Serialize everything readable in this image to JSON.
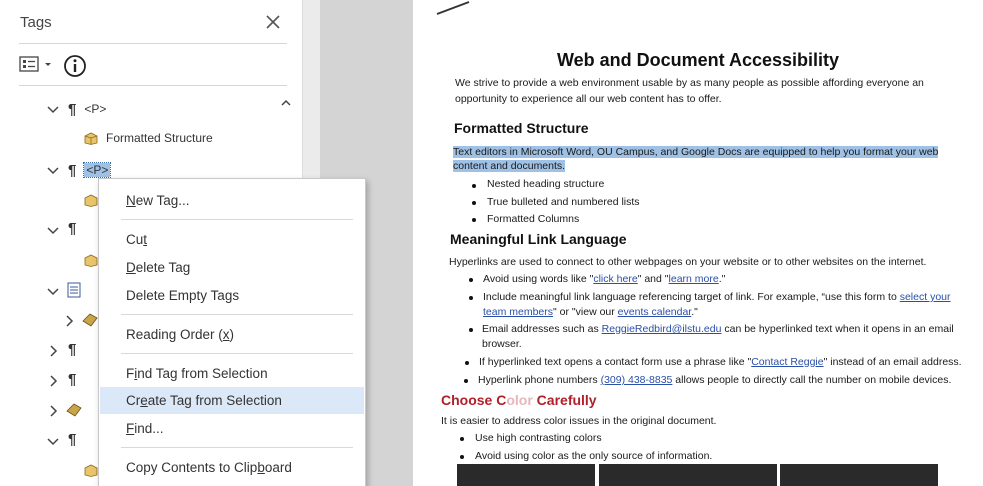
{
  "panel": {
    "title": "Tags",
    "tree": [
      {
        "kind": "para",
        "label": "<P>"
      },
      {
        "kind": "content",
        "label": "Formatted Structure"
      },
      {
        "kind": "para",
        "label": "<P>"
      }
    ]
  },
  "context_menu": {
    "items": [
      {
        "label": "New Tag...",
        "mnemonic_index": 0
      },
      {
        "label": "Cut",
        "mnemonic_index": 2
      },
      {
        "label": "Delete Tag",
        "mnemonic_index": 0
      },
      {
        "label": "Delete Empty Tags",
        "mnemonic_index": 15
      },
      {
        "label": "Reading Order (x)",
        "mnemonic_index": 15
      },
      {
        "label": "Find Tag from Selection",
        "mnemonic_index": 1
      },
      {
        "label": "Create Tag from Selection",
        "mnemonic_index": 2
      },
      {
        "label": "Find...",
        "mnemonic_index": 0
      },
      {
        "label": "Copy Contents to Clipboard",
        "mnemonic_index": 21
      }
    ]
  },
  "document": {
    "title": "Web and Document Accessibility",
    "intro": "We strive to provide a web environment usable by as many people as possible affording everyone an",
    "intro2": "opportunity to experience all our web content has to offer.",
    "h_formatted": "Formatted Structure",
    "formatted_p1": "Text editors in Microsoft Word, OU Campus, and Google Docs are equipped to help you format your web",
    "formatted_p2": "content and documents.",
    "formatted_bullets": [
      "Nested heading structure",
      "True bulleted and numbered lists",
      "Formatted Columns"
    ],
    "h_links": "Meaningful Link Language",
    "links_p": "Hyperlinks are used to connect to other webpages on your website or to other websites on the internet.",
    "b1_pre": "Avoid using words like \"",
    "b1_link1": "click here",
    "b1_mid": "\" and \"",
    "b1_link2": "learn more",
    "b1_post": ".\"",
    "b2_pre": "Include meaningful link language referencing target of link. For example, “use this form to ",
    "b2_link1": "select your",
    "b2_link1b": "team members",
    "b2_mid": "\" or \"view our ",
    "b2_link2": "events calendar",
    "b2_post": ".\"",
    "b3_pre": "Email addresses such as ",
    "b3_link": "ReggieRedbird@ilstu.edu",
    "b3_post": " can be hyperlinked text when it opens in an email",
    "b3_line2": "browser.",
    "b4_pre": "If hyperlinked text opens a contact form use a phrase like \"",
    "b4_link": "Contact Reggie",
    "b4_post": "\" instead of an email address.",
    "b5_pre": "Hyperlink phone numbers ",
    "b5_link": "(309) 438-8835",
    "b5_post": " allows people to directly call the number on mobile devices.",
    "h_color_a": "Choose C",
    "h_color_b": "olor",
    "h_color_c": " Carefully",
    "color_p": "It is easier to address color issues in the original document.",
    "color_bullets": [
      "Use high contrasting colors",
      "Avoid using color as the only source of information."
    ]
  },
  "colors": {
    "selection": "#9fc1e6",
    "menu_highlight": "#dbe8f7",
    "heading_red": "#b0202a",
    "link_blue": "#2a4fa8"
  }
}
